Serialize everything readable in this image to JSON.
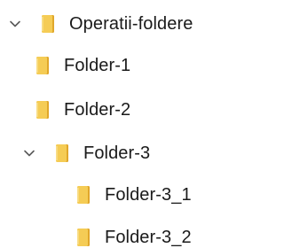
{
  "tree": {
    "accent_color": "#f2c94c",
    "chevron_color": "#5a5a5a",
    "nodes": [
      {
        "label": "Operatii-foldere",
        "state": "expanded",
        "icon": "folder-icon",
        "chevron": "chevron-down-icon"
      },
      {
        "label": "Folder-1",
        "state": "leaf",
        "icon": "folder-icon"
      },
      {
        "label": "Folder-2",
        "state": "leaf",
        "icon": "folder-icon"
      },
      {
        "label": "Folder-3",
        "state": "expanded",
        "icon": "folder-icon",
        "chevron": "chevron-down-icon"
      },
      {
        "label": "Folder-3_1",
        "state": "leaf",
        "icon": "folder-icon"
      },
      {
        "label": "Folder-3_2",
        "state": "leaf",
        "icon": "folder-icon"
      }
    ]
  }
}
